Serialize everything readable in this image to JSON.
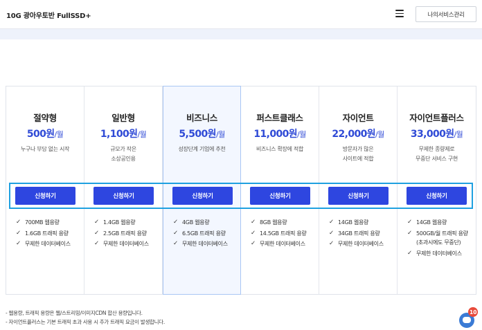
{
  "header": {
    "title": "10G 광아우토반 FullSSD+",
    "menu_icon": "hamburger-menu-icon",
    "service_button": "나의서비스관리"
  },
  "plans": [
    {
      "name": "절약형",
      "price": "500원",
      "unit": "/월",
      "desc": [
        "누구나 부담 없는 시작"
      ],
      "button": "신청하기",
      "features": [
        "700MB 웹용량",
        "1.6GB 트래픽 용량",
        "무제한 데이터베이스"
      ]
    },
    {
      "name": "일반형",
      "price": "1,100원",
      "unit": "/월",
      "desc": [
        "규모가 작은",
        "소상공인용"
      ],
      "button": "신청하기",
      "features": [
        "1.4GB 웹용량",
        "2.5GB 트래픽 용량",
        "무제한 데이터베이스"
      ]
    },
    {
      "name": "비즈니스",
      "price": "5,500원",
      "unit": "/월",
      "desc": [
        "성장단계 기업에 추천"
      ],
      "button": "신청하기",
      "features": [
        "4GB 웹용량",
        "6.5GB 트래픽 용량",
        "무제한 데이터베이스"
      ]
    },
    {
      "name": "퍼스트클래스",
      "price": "11,000원",
      "unit": "/월",
      "desc": [
        "비즈니스 확장에 적합"
      ],
      "button": "신청하기",
      "features": [
        "8GB 웹용량",
        "14.5GB 트래픽 용량",
        "무제한 데이터베이스"
      ]
    },
    {
      "name": "자이언트",
      "price": "22,000원",
      "unit": "/월",
      "desc": [
        "방문자가 많은",
        "사이트에 적합"
      ],
      "button": "신청하기",
      "features": [
        "14GB 웹용량",
        "34GB 트래픽 용량",
        "무제한 데이터베이스"
      ]
    },
    {
      "name": "자이언트플러스",
      "price": "33,000원",
      "unit": "/월",
      "desc": [
        "무제한 종량제로",
        "무중단 서비스 구현"
      ],
      "button": "신청하기",
      "features": [
        "14GB 웹용량",
        "500GB/월 트래픽 용량 (초과시에도 무중단)",
        "무제한 데이터베이스"
      ]
    }
  ],
  "notes": [
    "- 웹용량, 트래픽 용량은 웹/스트리밍/이미지CDN 합산 용량입니다.",
    "- 자이언트플러스는 기본 트래픽 초과 사용 시 추가 트래픽 요금이 발생합니다."
  ],
  "chat": {
    "icon": "chat-bubble-icon",
    "badge": "10"
  },
  "colors": {
    "accent": "#2e46e0",
    "price": "#2f4ad6",
    "highlight": "#1ea0e0",
    "band": "#eef2fb",
    "badge": "#e84a3a"
  }
}
